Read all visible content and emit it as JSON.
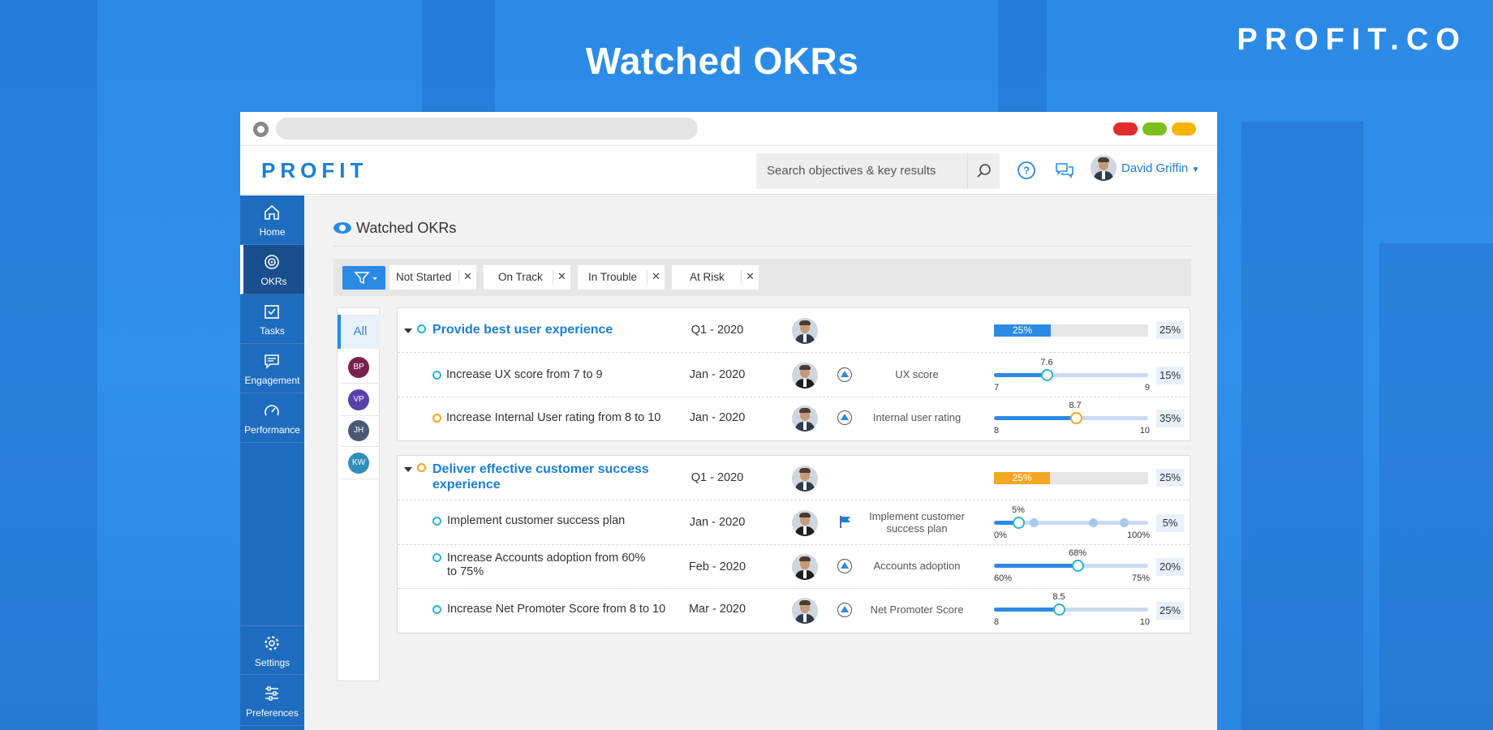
{
  "page": {
    "title": "Watched OKRs",
    "brand": "PROFIT.CO"
  },
  "window": {
    "controls": [
      "#e02c2c",
      "#7cbf1d",
      "#f5b400"
    ]
  },
  "header": {
    "logo": "PROFIT",
    "search_placeholder": "Search objectives & key results",
    "user_name": "David Griffin"
  },
  "sidebar": {
    "items": [
      {
        "label": "Home",
        "icon": "home-icon"
      },
      {
        "label": "OKRs",
        "icon": "target-icon",
        "active": true
      },
      {
        "label": "Tasks",
        "icon": "tasks-icon"
      },
      {
        "label": "Engagement",
        "icon": "chat-icon"
      },
      {
        "label": "Performance",
        "icon": "gauge-icon"
      }
    ],
    "bottom": [
      {
        "label": "Settings",
        "icon": "gear-icon"
      },
      {
        "label": "Preferences",
        "icon": "sliders-icon"
      }
    ]
  },
  "main": {
    "title": "Watched OKRs",
    "filters": [
      "Not Started",
      "On Track",
      "In Trouble",
      "At Risk"
    ],
    "people": {
      "all": "All",
      "avatars": [
        {
          "initials": "BP",
          "color": "#7b1f4f"
        },
        {
          "initials": "VP",
          "color": "#5a3fa8"
        },
        {
          "initials": "JH",
          "color": "#4a5a75"
        },
        {
          "initials": "KW",
          "color": "#2f8fb8"
        }
      ]
    },
    "objectives": [
      {
        "title": "Provide best user experience",
        "period": "Q1 - 2020",
        "progress": 25,
        "progress_label": "25%",
        "color": "#2b8ae6",
        "key_results": [
          {
            "title": "Increase UX score from 7 to 9",
            "period": "Jan - 2020",
            "metric": "UX score",
            "min": "7",
            "max": "9",
            "value": "7.6",
            "position": 0.34,
            "percent": "15%",
            "status": "blue"
          },
          {
            "title": "Increase Internal User rating from 8 to 10",
            "period": "Jan - 2020",
            "metric": "Internal user rating",
            "min": "8",
            "max": "10",
            "value": "8.7",
            "position": 0.53,
            "percent": "35%",
            "status": "orange"
          }
        ]
      },
      {
        "title": "Deliver effective customer success experience",
        "period": "Q1 - 2020",
        "progress": 25,
        "progress_label": "25%",
        "color": "#f5a623",
        "key_results": [
          {
            "title": "Implement customer success plan",
            "period": "Jan - 2020",
            "metric": "Implement customer success plan",
            "min": "0%",
            "max": "100%",
            "value": "5%",
            "position": 0.16,
            "percent": "5%",
            "status": "blue",
            "milestone": true
          },
          {
            "title": "Increase Accounts adoption from 60% to 75%",
            "period": "Feb - 2020",
            "metric": "Accounts adoption",
            "min": "60%",
            "max": "75%",
            "value": "68%",
            "position": 0.54,
            "percent": "20%",
            "status": "blue"
          },
          {
            "title": "Increase Net Promoter Score from 8 to 10",
            "period": "Mar - 2020",
            "metric": "Net Promoter Score",
            "min": "8",
            "max": "10",
            "value": "8.5",
            "position": 0.42,
            "percent": "25%",
            "status": "blue"
          }
        ]
      }
    ]
  }
}
